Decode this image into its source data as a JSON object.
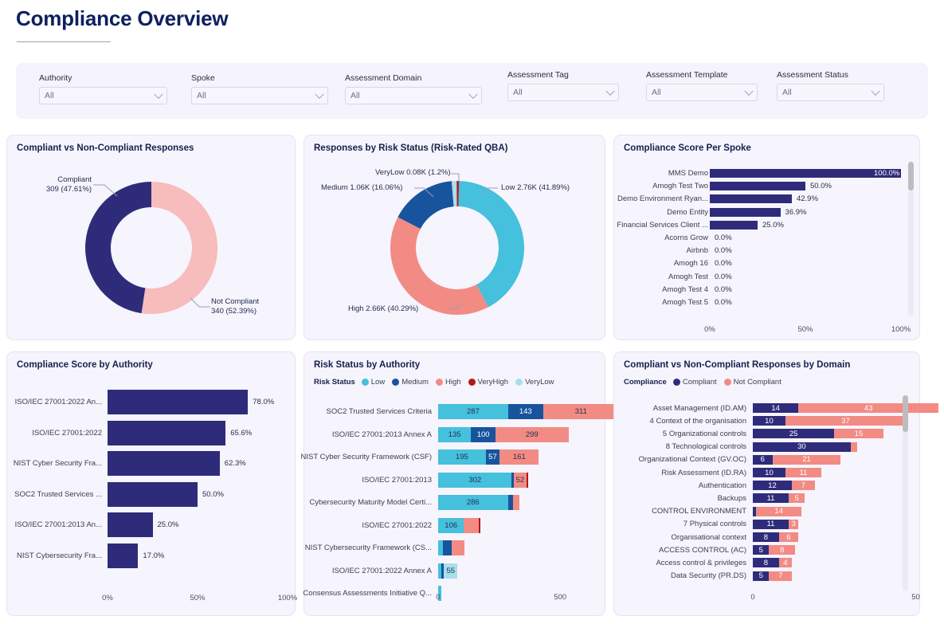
{
  "header": {
    "title": "Compliance Overview"
  },
  "filters": [
    {
      "label": "Authority",
      "value": "All",
      "placeholder": "All",
      "icon": "chevron-down-icon"
    },
    {
      "label": "Spoke",
      "value": "All",
      "placeholder": "All",
      "icon": "chevron-down-icon"
    },
    {
      "label": "Assessment Domain",
      "value": "All",
      "placeholder": "All",
      "icon": "chevron-down-icon"
    },
    {
      "label": "Assessment Tag",
      "value": "All",
      "placeholder": "All",
      "icon": "chevron-down-icon"
    },
    {
      "label": "Assessment Template",
      "value": "All",
      "placeholder": "All",
      "icon": "chevron-down-icon"
    },
    {
      "label": "Assessment Status",
      "value": "All",
      "placeholder": "All",
      "icon": "chevron-down-icon"
    }
  ],
  "colors": {
    "navy": "#2e2c7a",
    "navy_dark": "#232069",
    "pink": "#f7bcbc",
    "salmon": "#f28b84",
    "cyan": "#45c0dd",
    "blue_dark": "#18549e",
    "red_dark": "#b01a1a",
    "light_cyan": "#a7e0ec",
    "panel_bg": "#f6f4fc",
    "title": "#16204e"
  },
  "panels": {
    "compliance_donut": {
      "title": "Compliant vs Non-Compliant Responses"
    },
    "risk_donut": {
      "title": "Responses by Risk Status (Risk-Rated QBA)"
    },
    "spoke_bars": {
      "title": "Compliance Score Per Spoke"
    },
    "authority_bars": {
      "title": "Compliance Score by Authority"
    },
    "risk_by_authority": {
      "title": "Risk Status by Authority"
    },
    "domain_bars": {
      "title": "Compliant vs Non-Compliant Responses by Domain"
    }
  },
  "chart_data": [
    {
      "id": "compliance_donut",
      "type": "pie",
      "title": "Compliant vs Non-Compliant Responses",
      "legend": "none",
      "slices": [
        {
          "name": "Compliant",
          "value": 309,
          "percent": 47.61,
          "label": "Compliant\n309 (47.61%)",
          "label_line1": "Compliant",
          "label_line2": "309 (47.61%)",
          "color": "#2e2c7a"
        },
        {
          "name": "Not Compliant",
          "value": 340,
          "percent": 52.39,
          "label": "Not Compliant\n340 (52.39%)",
          "label_line1": "Not Compliant",
          "label_line2": "340 (52.39%)",
          "color": "#f7bcbc"
        }
      ]
    },
    {
      "id": "risk_donut",
      "type": "pie",
      "title": "Responses by Risk Status (Risk-Rated QBA)",
      "legend": "none",
      "slices": [
        {
          "name": "Low",
          "value": 2760,
          "percent": 41.89,
          "label": "Low 2.76K (41.89%)",
          "color": "#45c0dd"
        },
        {
          "name": "High",
          "value": 2660,
          "percent": 40.29,
          "label": "High 2.66K (40.29%)",
          "color": "#f28b84"
        },
        {
          "name": "Medium",
          "value": 1060,
          "percent": 16.06,
          "label": "Medium 1.06K (16.06%)",
          "color": "#18549e"
        },
        {
          "name": "VeryLow",
          "value": 80,
          "percent": 1.2,
          "label": "VeryLow 0.08K (1.2%)",
          "color": "#a7e0ec"
        },
        {
          "name": "VeryHigh",
          "value": 37,
          "percent": 0.56,
          "label": "",
          "color": "#b01a1a"
        }
      ]
    },
    {
      "id": "spoke_bars",
      "type": "bar",
      "orientation": "horizontal",
      "title": "Compliance Score Per Spoke",
      "xlim": [
        0,
        100
      ],
      "xticks": [
        "0%",
        "50%",
        "100%"
      ],
      "categories": [
        "MMS Demo",
        "Amogh Test Two",
        "Demo Environment Ryan...",
        "Demo Entity",
        "Financial Services Client ...",
        "Acorns Grow",
        "Airbnb",
        "Amogh 16",
        "Amogh Test",
        "Amogh Test 4",
        "Amogh Test 5"
      ],
      "values": [
        100.0,
        50.0,
        42.9,
        36.9,
        25.0,
        0.0,
        0.0,
        0.0,
        0.0,
        0.0,
        0.0
      ],
      "value_labels": [
        "100.0%",
        "50.0%",
        "42.9%",
        "36.9%",
        "25.0%",
        "0.0%",
        "0.0%",
        "0.0%",
        "0.0%",
        "0.0%",
        "0.0%"
      ],
      "color": "#2e2c7a",
      "scrollable": true
    },
    {
      "id": "authority_bars",
      "type": "bar",
      "orientation": "horizontal",
      "title": "Compliance Score by Authority",
      "xlim": [
        0,
        100
      ],
      "xticks": [
        "0%",
        "50%",
        "100%"
      ],
      "categories": [
        "ISO/IEC 27001:2022 An...",
        "ISO/IEC 27001:2022",
        "NIST Cyber Security Fra...",
        "SOC2 Trusted Services ...",
        "ISO/IEC 27001:2013 An...",
        "NIST Cybersecurity Fra..."
      ],
      "values": [
        78.0,
        65.6,
        62.3,
        50.0,
        25.0,
        17.0
      ],
      "value_labels": [
        "78.0%",
        "65.6%",
        "62.3%",
        "50.0%",
        "25.0%",
        "17.0%"
      ],
      "color": "#2e2c7a"
    },
    {
      "id": "risk_by_authority",
      "type": "bar",
      "stacked": true,
      "orientation": "horizontal",
      "title": "Risk Status by Authority",
      "legend_title": "Risk Status",
      "legend_position": "top",
      "xlim": [
        0,
        800
      ],
      "xticks": [
        "0",
        "500"
      ],
      "series": [
        {
          "name": "Low",
          "color": "#45c0dd"
        },
        {
          "name": "Medium",
          "color": "#18549e"
        },
        {
          "name": "High",
          "color": "#f28b84"
        },
        {
          "name": "VeryHigh",
          "color": "#b01a1a"
        },
        {
          "name": "VeryLow",
          "color": "#a7e0ec"
        }
      ],
      "categories": [
        "SOC2 Trusted Services Criteria",
        "ISO/IEC 27001:2013 Annex A",
        "NIST Cyber Security Framework (CSF)",
        "ISO/IEC 27001:2013",
        "Cybersecurity Maturity Model Certi...",
        "ISO/IEC 27001:2022",
        "NIST Cybersecurity Framework (CS...",
        "ISO/IEC 27001:2022 Annex A",
        "Consensus Assessments Initiative Q..."
      ],
      "rows": [
        {
          "category": "SOC2 Trusted Services Criteria",
          "segments": [
            {
              "name": "Low",
              "value": 287,
              "label": "287"
            },
            {
              "name": "Medium",
              "value": 143,
              "label": "143"
            },
            {
              "name": "High",
              "value": 311,
              "label": "311"
            },
            {
              "name": "VeryHigh",
              "value": 0,
              "label": ""
            },
            {
              "name": "VeryLow",
              "value": 0,
              "label": ""
            }
          ]
        },
        {
          "category": "ISO/IEC 27001:2013 Annex A",
          "segments": [
            {
              "name": "Low",
              "value": 135,
              "label": "135"
            },
            {
              "name": "Medium",
              "value": 100,
              "label": "100"
            },
            {
              "name": "High",
              "value": 299,
              "label": "299"
            },
            {
              "name": "VeryHigh",
              "value": 0,
              "label": ""
            },
            {
              "name": "VeryLow",
              "value": 0,
              "label": ""
            }
          ]
        },
        {
          "category": "NIST Cyber Security Framework (CSF)",
          "segments": [
            {
              "name": "Low",
              "value": 195,
              "label": "195"
            },
            {
              "name": "Medium",
              "value": 57,
              "label": "57"
            },
            {
              "name": "High",
              "value": 161,
              "label": "161"
            },
            {
              "name": "VeryHigh",
              "value": 0,
              "label": ""
            },
            {
              "name": "VeryLow",
              "value": 0,
              "label": ""
            }
          ]
        },
        {
          "category": "ISO/IEC 27001:2013",
          "segments": [
            {
              "name": "Low",
              "value": 302,
              "label": "302"
            },
            {
              "name": "Medium",
              "value": 8,
              "label": ""
            },
            {
              "name": "High",
              "value": 52,
              "label": "52"
            },
            {
              "name": "VeryHigh",
              "value": 6,
              "label": ""
            },
            {
              "name": "VeryLow",
              "value": 0,
              "label": ""
            }
          ]
        },
        {
          "category": "Cybersecurity Maturity Model Certi...",
          "segments": [
            {
              "name": "Low",
              "value": 286,
              "label": "286"
            },
            {
              "name": "Medium",
              "value": 22,
              "label": ""
            },
            {
              "name": "High",
              "value": 24,
              "label": ""
            },
            {
              "name": "VeryHigh",
              "value": 0,
              "label": ""
            },
            {
              "name": "VeryLow",
              "value": 0,
              "label": ""
            }
          ]
        },
        {
          "category": "ISO/IEC 27001:2022",
          "segments": [
            {
              "name": "Low",
              "value": 106,
              "label": "106"
            },
            {
              "name": "Medium",
              "value": 0,
              "label": ""
            },
            {
              "name": "High",
              "value": 62,
              "label": ""
            },
            {
              "name": "VeryHigh",
              "value": 5,
              "label": ""
            },
            {
              "name": "VeryLow",
              "value": 0,
              "label": ""
            }
          ]
        },
        {
          "category": "NIST Cybersecurity Framework (CS...",
          "segments": [
            {
              "name": "Low",
              "value": 18,
              "label": ""
            },
            {
              "name": "Medium",
              "value": 38,
              "label": ""
            },
            {
              "name": "High",
              "value": 52,
              "label": ""
            },
            {
              "name": "VeryHigh",
              "value": 0,
              "label": ""
            },
            {
              "name": "VeryLow",
              "value": 0,
              "label": ""
            }
          ]
        },
        {
          "category": "ISO/IEC 27001:2022 Annex A",
          "segments": [
            {
              "name": "Low",
              "value": 12,
              "label": ""
            },
            {
              "name": "Medium",
              "value": 12,
              "label": ""
            },
            {
              "name": "High",
              "value": 0,
              "label": ""
            },
            {
              "name": "VeryHigh",
              "value": 0,
              "label": ""
            },
            {
              "name": "VeryLow",
              "value": 55,
              "label": "55"
            }
          ]
        },
        {
          "category": "Consensus Assessments Initiative Q...",
          "segments": [
            {
              "name": "Low",
              "value": 14,
              "label": ""
            },
            {
              "name": "Medium",
              "value": 0,
              "label": ""
            },
            {
              "name": "High",
              "value": 0,
              "label": ""
            },
            {
              "name": "VeryHigh",
              "value": 0,
              "label": ""
            },
            {
              "name": "VeryLow",
              "value": 0,
              "label": ""
            }
          ]
        }
      ]
    },
    {
      "id": "domain_bars",
      "type": "bar",
      "stacked": true,
      "orientation": "horizontal",
      "title": "Compliant vs Non-Compliant Responses by Domain",
      "legend_title": "Compliance",
      "legend_position": "top",
      "xlim": [
        0,
        66
      ],
      "xticks": [
        "0",
        "50"
      ],
      "series": [
        {
          "name": "Compliant",
          "color": "#2e2c7a"
        },
        {
          "name": "Not Compliant",
          "color": "#f28b84"
        }
      ],
      "rows": [
        {
          "category": "Asset Management (ID.AM)",
          "compliant": 14,
          "not_compliant": 43,
          "compliant_label": "14",
          "not_compliant_label": "43"
        },
        {
          "category": "4 Context of the organisation",
          "compliant": 10,
          "not_compliant": 37,
          "compliant_label": "10",
          "not_compliant_label": "37"
        },
        {
          "category": "5 Organizational controls",
          "compliant": 25,
          "not_compliant": 15,
          "compliant_label": "25",
          "not_compliant_label": "15"
        },
        {
          "category": "8 Technological controls",
          "compliant": 30,
          "not_compliant": 2,
          "compliant_label": "30",
          "not_compliant_label": ""
        },
        {
          "category": "Organizational Context (GV.OC)",
          "compliant": 6,
          "not_compliant": 21,
          "compliant_label": "6",
          "not_compliant_label": "21"
        },
        {
          "category": "Risk Assessment (ID.RA)",
          "compliant": 10,
          "not_compliant": 11,
          "compliant_label": "10",
          "not_compliant_label": "11"
        },
        {
          "category": "Authentication",
          "compliant": 12,
          "not_compliant": 7,
          "compliant_label": "12",
          "not_compliant_label": "7"
        },
        {
          "category": "Backups",
          "compliant": 11,
          "not_compliant": 5,
          "compliant_label": "11",
          "not_compliant_label": "5"
        },
        {
          "category": "CONTROL ENVIRONMENT",
          "compliant": 1,
          "not_compliant": 14,
          "compliant_label": "",
          "not_compliant_label": "14"
        },
        {
          "category": "7 Physical controls",
          "compliant": 11,
          "not_compliant": 3,
          "compliant_label": "11",
          "not_compliant_label": "3"
        },
        {
          "category": "Organisational context",
          "compliant": 8,
          "not_compliant": 6,
          "compliant_label": "8",
          "not_compliant_label": "6"
        },
        {
          "category": "ACCESS CONTROL (AC)",
          "compliant": 5,
          "not_compliant": 8,
          "compliant_label": "5",
          "not_compliant_label": "8"
        },
        {
          "category": "Access control & privileges",
          "compliant": 8,
          "not_compliant": 4,
          "compliant_label": "8",
          "not_compliant_label": "4"
        },
        {
          "category": "Data Security (PR.DS)",
          "compliant": 5,
          "not_compliant": 7,
          "compliant_label": "5",
          "not_compliant_label": "7"
        }
      ],
      "scrollable": true
    }
  ]
}
